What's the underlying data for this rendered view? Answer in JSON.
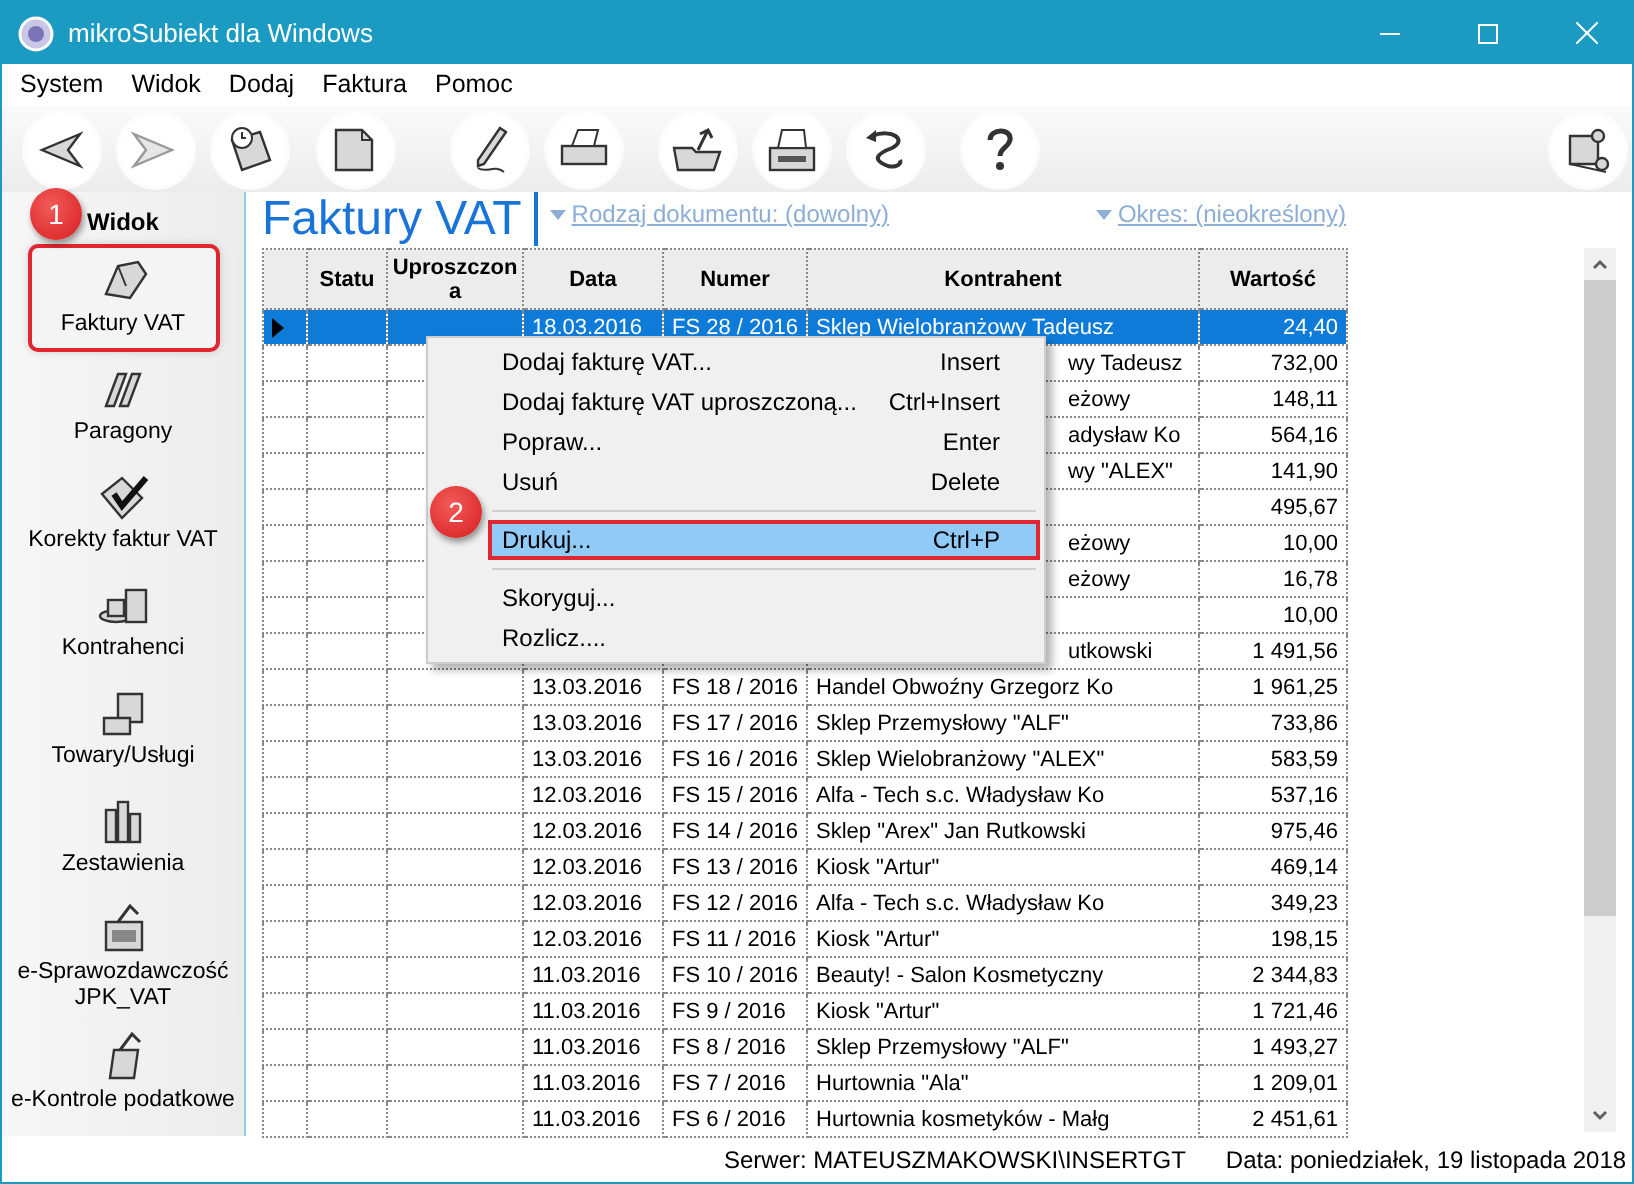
{
  "window": {
    "title": "mikroSubiekt dla Windows"
  },
  "menu": [
    "System",
    "Widok",
    "Dodaj",
    "Faktura",
    "Pomoc"
  ],
  "sidebar": {
    "title": "Widok",
    "badge": "1",
    "items": [
      {
        "label": "Faktury VAT",
        "selected": true
      },
      {
        "label": "Paragony",
        "selected": false
      },
      {
        "label": "Korekty faktur VAT",
        "selected": false
      },
      {
        "label": "Kontrahenci",
        "selected": false
      },
      {
        "label": "Towary/Usługi",
        "selected": false
      },
      {
        "label": "Zestawienia",
        "selected": false
      },
      {
        "label": "e-Sprawozdawczość JPK_VAT",
        "selected": false
      },
      {
        "label": "e-Kontrole podatkowe",
        "selected": false
      }
    ]
  },
  "view": {
    "title": "Faktury VAT",
    "filters": [
      {
        "label": "Rodzaj dokumentu: (dowolny)"
      },
      {
        "label": "Okres: (nieokreślony)"
      }
    ]
  },
  "table": {
    "columns": [
      "Statu",
      "Uproszczona",
      "Data",
      "Numer",
      "Kontrahent",
      "Wartość"
    ],
    "rows": [
      {
        "date": "18.03.2016",
        "number": "FS 28 / 2016",
        "contractor": "Sklep Wielobranżowy Tadeusz",
        "value": "24,40",
        "selected": true
      },
      {
        "contractor": "wy Tadeusz",
        "value": "732,00",
        "selected": false
      },
      {
        "contractor": "eżowy",
        "value": "148,11",
        "selected": false
      },
      {
        "contractor": "adysław Ko",
        "value": "564,16",
        "selected": false
      },
      {
        "contractor": "wy  \"ALEX\"",
        "value": "141,90",
        "selected": false
      },
      {
        "value": "495,67",
        "selected": false
      },
      {
        "contractor": "eżowy",
        "value": "10,00",
        "selected": false
      },
      {
        "contractor": "eżowy",
        "value": "16,78",
        "selected": false
      },
      {
        "value": "10,00",
        "selected": false
      },
      {
        "contractor": "utkowski",
        "value": "1 491,56",
        "selected": false
      },
      {
        "date": "13.03.2016",
        "number": "FS 18 / 2016",
        "contractor": "Handel Obwoźny Grzegorz Ko",
        "value": "1 961,25",
        "selected": false
      },
      {
        "date": "13.03.2016",
        "number": "FS 17 / 2016",
        "contractor": "Sklep Przemysłowy \"ALF\"",
        "value": "733,86",
        "selected": false
      },
      {
        "date": "13.03.2016",
        "number": "FS 16 / 2016",
        "contractor": "Sklep Wielobranżowy  \"ALEX\"",
        "value": "583,59",
        "selected": false
      },
      {
        "date": "12.03.2016",
        "number": "FS 15 / 2016",
        "contractor": "Alfa - Tech s.c. Władysław Ko",
        "value": "537,16",
        "selected": false
      },
      {
        "date": "12.03.2016",
        "number": "FS 14 / 2016",
        "contractor": "Sklep \"Arex\" Jan Rutkowski",
        "value": "975,46",
        "selected": false
      },
      {
        "date": "12.03.2016",
        "number": "FS 13 / 2016",
        "contractor": "Kiosk \"Artur\"",
        "value": "469,14",
        "selected": false
      },
      {
        "date": "12.03.2016",
        "number": "FS 12 / 2016",
        "contractor": "Alfa - Tech s.c. Władysław Ko",
        "value": "349,23",
        "selected": false
      },
      {
        "date": "12.03.2016",
        "number": "FS 11 / 2016",
        "contractor": "Kiosk \"Artur\"",
        "value": "198,15",
        "selected": false
      },
      {
        "date": "11.03.2016",
        "number": "FS 10 / 2016",
        "contractor": "Beauty! - Salon Kosmetyczny",
        "value": "2 344,83",
        "selected": false
      },
      {
        "date": "11.03.2016",
        "number": "FS 9 / 2016",
        "contractor": "Kiosk \"Artur\"",
        "value": "1 721,46",
        "selected": false
      },
      {
        "date": "11.03.2016",
        "number": "FS 8 / 2016",
        "contractor": "Sklep Przemysłowy \"ALF\"",
        "value": "1 493,27",
        "selected": false
      },
      {
        "date": "11.03.2016",
        "number": "FS 7 / 2016",
        "contractor": "Hurtownia \"Ala\"",
        "value": "1 209,01",
        "selected": false
      },
      {
        "date": "11.03.2016",
        "number": "FS 6 / 2016",
        "contractor": "Hurtownia kosmetyków - Małg",
        "value": "2 451,61",
        "selected": false
      }
    ]
  },
  "context_menu": {
    "badge": "2",
    "items": [
      {
        "kind": "item",
        "label": "Dodaj fakturę VAT...",
        "shortcut": "Insert",
        "selected": false
      },
      {
        "kind": "item",
        "label": "Dodaj fakturę VAT uproszczoną...",
        "shortcut": "Ctrl+Insert",
        "selected": false
      },
      {
        "kind": "item",
        "label": "Popraw...",
        "shortcut": "Enter",
        "selected": false
      },
      {
        "kind": "item",
        "label": "Usuń",
        "shortcut": "Delete",
        "selected": false
      },
      {
        "kind": "separator"
      },
      {
        "kind": "item",
        "label": "Drukuj...",
        "shortcut": "Ctrl+P",
        "selected": true
      },
      {
        "kind": "separator"
      },
      {
        "kind": "item",
        "label": "Skoryguj...",
        "selected": false
      },
      {
        "kind": "item",
        "label": "Rozlicz....",
        "selected": false
      }
    ]
  },
  "status_bar": [
    "Serwer: MATEUSZMAKOWSKI\\INSERTGT",
    "Data: poniedziałek, 19 listopada 2018"
  ]
}
